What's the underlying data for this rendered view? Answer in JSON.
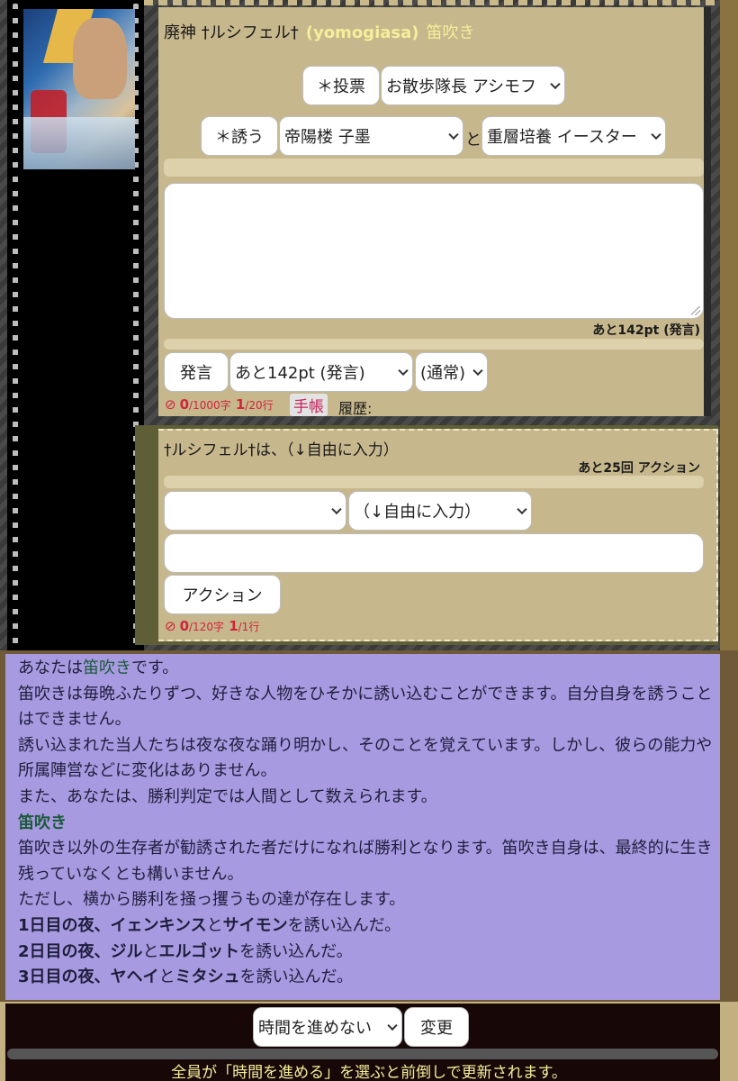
{
  "panel1": {
    "title_name": "廃神 †ルシフェル†",
    "title_user": "(yomogiasa)",
    "title_role": "笛吹き",
    "vote_button": "＊投票",
    "vote_select": "お散歩隊長 アシモフ",
    "invite_button": "＊誘う",
    "invite_select_1": "帝陽楼 子墨",
    "and_label": "と",
    "invite_select_2": "重層培養 イースター",
    "points_label": "あと142pt (発言)",
    "say_button": "発言",
    "say_mode_select": "あと142pt (発言)",
    "say_style_select": "(通常)",
    "char_count": "0",
    "char_unit": "/1000字",
    "line_count": "1",
    "line_unit": "/20行",
    "notebook_tag": "手帳",
    "history_label": "履歴:"
  },
  "panel2": {
    "title": "†ルシフェル†は、（↓自由に入力）",
    "remaining": "あと25回 アクション",
    "target_select": "",
    "action_select": "（↓自由に入力）",
    "action_button": "アクション",
    "char_count": "0",
    "char_unit": "/120字",
    "line_count": "1",
    "line_unit": "/1行"
  },
  "info": {
    "line1_pre": "あなたは",
    "line1_role": "笛吹き",
    "line1_post": "です。",
    "line2": "笛吹きは毎晩ふたりずつ、好きな人物をひそかに誘い込むことができます。自分自身を誘うことはできません。",
    "line3": "誘い込まれた当人たちは夜な夜な踊り明かし、そのことを覚えています。しかし、彼らの能力や所属陣営などに変化はありません。",
    "line4": "また、あなたは、勝利判定では人間として数えられます。",
    "heading": "笛吹き",
    "line5": "笛吹き以外の生存者が勧誘された者だけになれば勝利となります。笛吹き自身は、最終的に生き残っていなくとも構いません。",
    "line6": "ただし、横から勝利を掻っ攫うもの達が存在します。",
    "log": [
      {
        "day": "1日目の夜、",
        "a": "イェンキンス",
        "and": "と",
        "b": "サイモン",
        "tail": "を誘い込んだ。"
      },
      {
        "day": "2日目の夜、",
        "a": "ジル",
        "and": "と",
        "b": "エルゴット",
        "tail": "を誘い込んだ。"
      },
      {
        "day": "3日目の夜、",
        "a": "ヤヘイ",
        "and": "と",
        "b": "ミタシュ",
        "tail": "を誘い込んだ。"
      }
    ]
  },
  "footer": {
    "time_select": "時間を進めない",
    "change_button": "変更",
    "notice": "全員が「時間を進める」を選ぶと前倒しで更新されます。"
  }
}
